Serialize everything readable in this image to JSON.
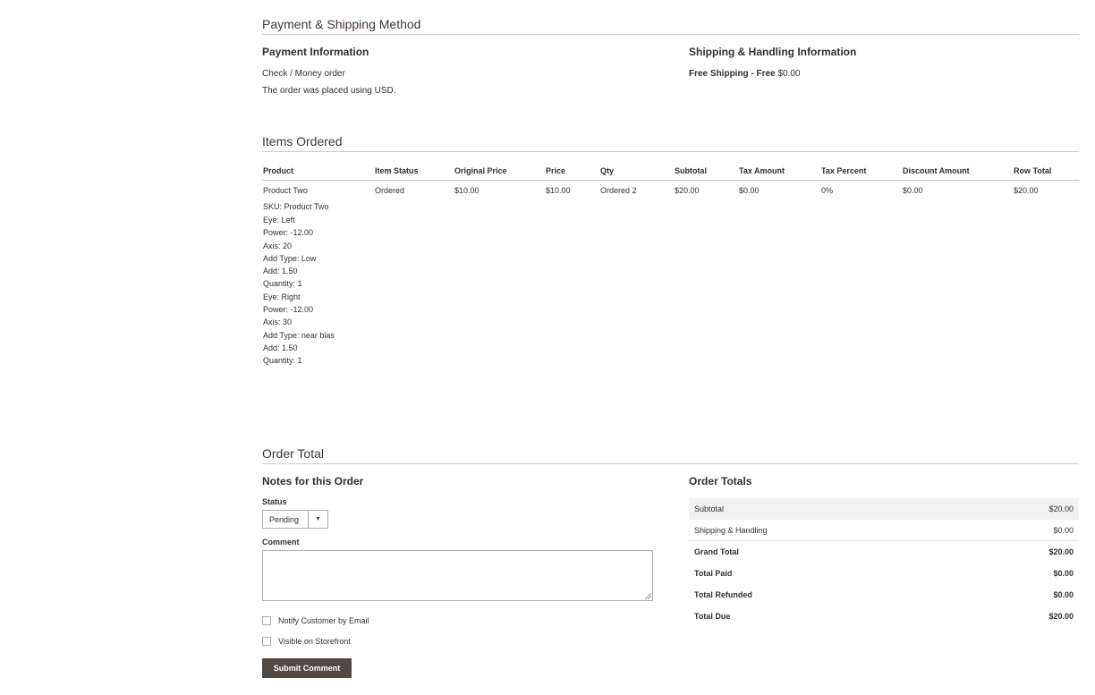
{
  "payment_shipping": {
    "section_title": "Payment & Shipping Method",
    "payment_title": "Payment Information",
    "payment_method": "Check / Money order",
    "currency_note": "The order was placed using USD.",
    "shipping_title": "Shipping & Handling Information",
    "shipping_method": "Free Shipping - Free",
    "shipping_price": "$0.00"
  },
  "items": {
    "section_title": "Items Ordered",
    "columns": [
      "Product",
      "Item Status",
      "Original Price",
      "Price",
      "Qty",
      "Subtotal",
      "Tax Amount",
      "Tax Percent",
      "Discount Amount",
      "Row Total"
    ],
    "rows": [
      {
        "product": "Product Two",
        "sku": "SKU: Product Two",
        "options": [
          "Eye: Left",
          "Power: -12.00",
          "Axis: 20",
          "Add Type: Low",
          "Add: 1.50",
          "Quantity: 1",
          "Eye: Right",
          "Power: -12.00",
          "Axis: 30",
          "Add Type: near bias",
          "Add: 1.50",
          "Quantity: 1"
        ],
        "status": "Ordered",
        "original_price": "$10.00",
        "price": "$10.00",
        "qty": "Ordered 2",
        "subtotal": "$20.00",
        "tax_amount": "$0.00",
        "tax_percent": "0%",
        "discount": "$0.00",
        "row_total": "$20.00"
      }
    ]
  },
  "order_total": {
    "section_title": "Order Total",
    "notes_title": "Notes for this Order",
    "status_label": "Status",
    "status_value": "Pending",
    "comment_label": "Comment",
    "comment_value": "",
    "notify_label": "Notify Customer by Email",
    "visible_label": "Visible on Storefront",
    "submit_label": "Submit Comment",
    "totals_title": "Order Totals",
    "totals": [
      {
        "label": "Subtotal",
        "value": "$20.00"
      },
      {
        "label": "Shipping & Handling",
        "value": "$0.00"
      },
      {
        "label": "Grand Total",
        "value": "$20.00"
      },
      {
        "label": "Total Paid",
        "value": "$0.00"
      },
      {
        "label": "Total Refunded",
        "value": "$0.00"
      },
      {
        "label": "Total Due",
        "value": "$20.00"
      }
    ]
  },
  "colors": {
    "button_bg": "#514943",
    "title_color": "#41362f",
    "shaded_row": "#f1f1f1"
  },
  "icons": {
    "select_arrow": "triangle-down-icon",
    "resize": "resize-handle-icon"
  }
}
